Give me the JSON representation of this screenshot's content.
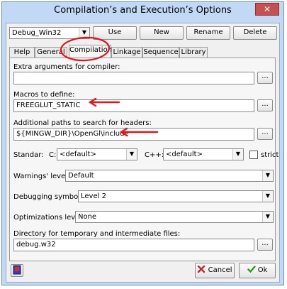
{
  "window": {
    "title": "Compilation’s and Execution’s Options",
    "close_glyph": "✕"
  },
  "profile": {
    "selected": "Debug_Win32",
    "use_label": "Use",
    "new_label": "New",
    "rename_label": "Rename",
    "delete_label": "Delete"
  },
  "tabs": [
    "Help",
    "General",
    "Compilation",
    "Linkage",
    "Sequence",
    "Library"
  ],
  "active_tab": "Compilation",
  "compilation": {
    "extra_args_label": "Extra arguments for compiler:",
    "extra_args_value": "",
    "macros_label": "Macros to define:",
    "macros_value": "FREEGLUT_STATIC",
    "headers_label": "Additional paths to search for headers:",
    "headers_value": "${MINGW_DIR}\\OpenGl\\include",
    "browse_label": "...",
    "standar_label": "Standar:",
    "c_label": "C:",
    "c_value": "<default>",
    "cpp_label": "C++:",
    "cpp_value": "<default>",
    "strict_label": "strict",
    "strict_checked": false,
    "warnings_label": "Warnings' level:",
    "warnings_value": "Default",
    "debug_label": "Debugging symbols:",
    "debug_value": "Level 2",
    "optim_label": "Optimizations level:",
    "optim_value": "None",
    "tempdir_label": "Directory for temporary and intermediate files:",
    "tempdir_value": "debug.w32"
  },
  "footer": {
    "cancel_label": "Cancel",
    "ok_label": "Ok",
    "help_icon": "book-icon"
  },
  "colors": {
    "annotation": "#e8141a",
    "ok_check": "#1e9e1e",
    "cancel_x": "#c0282a"
  }
}
